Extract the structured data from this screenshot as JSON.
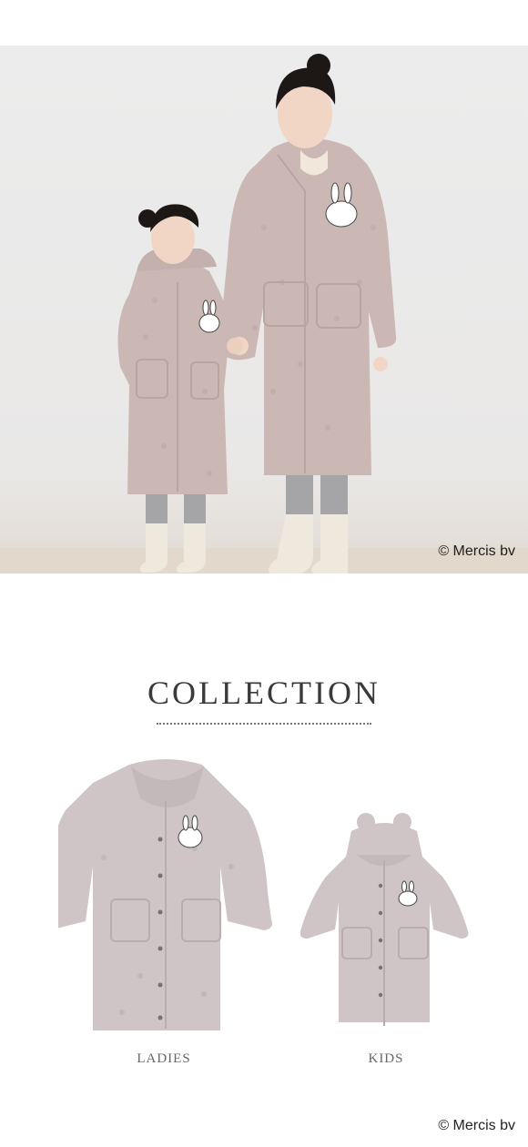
{
  "hero": {
    "alt": "Mother and daughter wearing matching pink fleece hooded robes",
    "credit": "© Mercis bv"
  },
  "collection": {
    "title": "COLLECTION",
    "items": [
      {
        "label": "LADIES"
      },
      {
        "label": "KIDS"
      }
    ]
  },
  "footer": {
    "credit": "© Mercis bv"
  },
  "colors": {
    "coat_hero": "#cbb8b4",
    "coat_product": "#cfc5c6",
    "legging": "#a5a5a7",
    "socks": "#efe8dd"
  }
}
